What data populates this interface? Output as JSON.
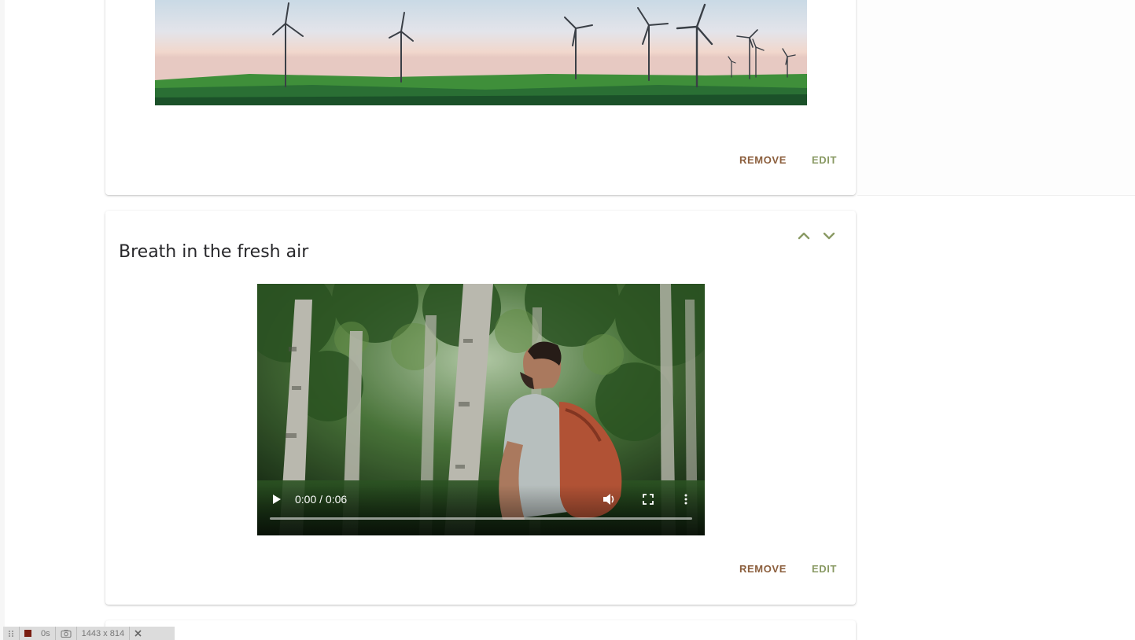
{
  "cards": [
    {
      "media": "wind-turbines-image",
      "actions": {
        "remove_label": "REMOVE",
        "edit_label": "EDIT"
      }
    },
    {
      "title": "Breath in the fresh air",
      "reorder": {
        "up_icon": "chevron-up-icon",
        "down_icon": "chevron-down-icon"
      },
      "video": {
        "time": "0:00 / 0:06",
        "progress": 0,
        "icons": [
          "play-icon",
          "volume-icon",
          "fullscreen-icon",
          "more-vert-icon"
        ]
      },
      "actions": {
        "remove_label": "REMOVE",
        "edit_label": "EDIT"
      }
    }
  ],
  "devbar": {
    "drag_icon": "drag-handle-icon",
    "record_icon": "record-icon",
    "duration": "0s",
    "camera_icon": "camera-icon",
    "size": "1443 x 814",
    "close_icon": "close-icon"
  },
  "colors": {
    "remove": "#8b5e3c",
    "edit": "#8a9a64",
    "title": "#27272a"
  }
}
